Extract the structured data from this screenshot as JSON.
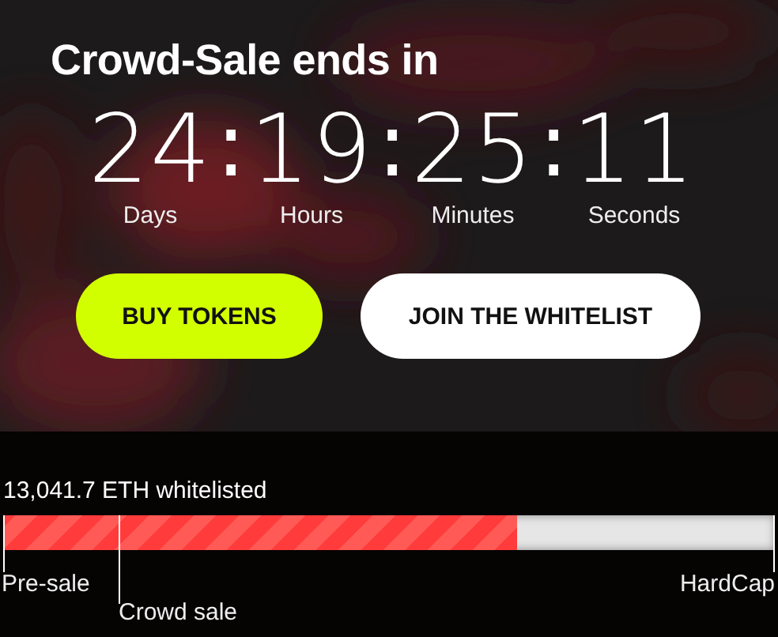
{
  "countdown": {
    "title": "Crowd-Sale ends in",
    "units": [
      {
        "value": "24",
        "label": "Days"
      },
      {
        "value": "19",
        "label": "Hours"
      },
      {
        "value": "25",
        "label": "Minutes"
      },
      {
        "value": "11",
        "label": "Seconds"
      }
    ],
    "separator": ":"
  },
  "buttons": [
    {
      "label": "BUY TOKENS",
      "kind": "primary"
    },
    {
      "label": "JOIN THE WHITELIST",
      "kind": "secondary"
    }
  ],
  "progress": {
    "caption": "13,041.7 ETH whitelisted",
    "level": 0.665,
    "milestones": [
      {
        "label": "Pre-sale"
      },
      {
        "label": "Crowd sale"
      },
      {
        "label": "HardCap"
      }
    ]
  }
}
